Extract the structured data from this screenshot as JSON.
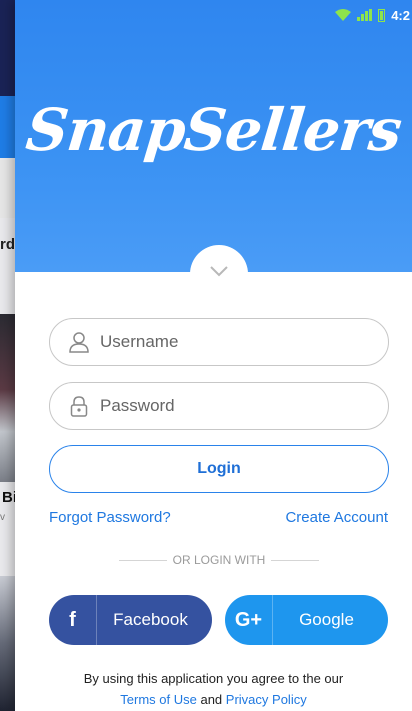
{
  "background": {
    "label_1": "rd",
    "label_2": "Bi",
    "label_2_sub": "v"
  },
  "status_bar": {
    "time": "4:2",
    "icons": [
      "wifi-icon",
      "signal-icon",
      "battery-icon"
    ]
  },
  "app": {
    "logo": "SnapSellers",
    "brand_color": "#2f86ef"
  },
  "form": {
    "username_placeholder": "Username",
    "password_placeholder": "Password",
    "login_label": "Login",
    "forgot_password": "Forgot Password?",
    "create_account": "Create Account",
    "divider_text": "OR LOGIN WITH"
  },
  "social": {
    "facebook": {
      "icon": "f",
      "label": "Facebook",
      "color": "#3552a0"
    },
    "google": {
      "icon": "G+",
      "label": "Google",
      "color": "#1e96ee"
    }
  },
  "footer": {
    "text": "By using this application you agree to the our",
    "terms": "Terms of Use",
    "and": "and",
    "privacy": "Privacy Policy"
  }
}
